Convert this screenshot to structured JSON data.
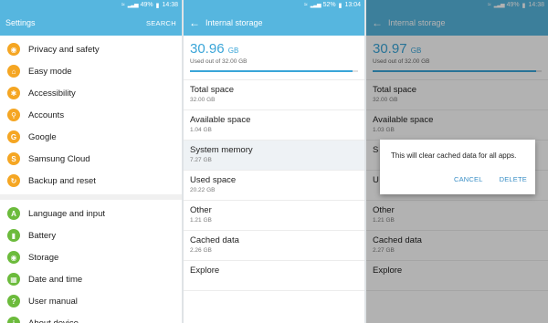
{
  "status": {
    "p1_battery": "49%",
    "p1_time": "14:38",
    "p2_battery": "52%",
    "p2_time": "13:04",
    "p3_battery": "49%",
    "p3_time": "14:38"
  },
  "settings": {
    "title": "Settings",
    "search_label": "SEARCH",
    "items": [
      {
        "label": "Privacy and safety",
        "icon": "privacy-icon",
        "color": "#f5a623"
      },
      {
        "label": "Easy mode",
        "icon": "easy-mode-icon",
        "color": "#f5a623"
      },
      {
        "label": "Accessibility",
        "icon": "accessibility-icon",
        "color": "#f5a623"
      },
      {
        "label": "Accounts",
        "icon": "key-icon",
        "color": "#f5a623"
      },
      {
        "label": "Google",
        "icon": "google-icon",
        "color": "#f5a623"
      },
      {
        "label": "Samsung Cloud",
        "icon": "samsung-cloud-icon",
        "color": "#f5a623"
      },
      {
        "label": "Backup and reset",
        "icon": "backup-icon",
        "color": "#f5a623"
      },
      {
        "label": "Language and input",
        "icon": "language-icon",
        "color": "#6cbb3c"
      },
      {
        "label": "Battery",
        "icon": "battery-icon",
        "color": "#6cbb3c"
      },
      {
        "label": "Storage",
        "icon": "storage-icon",
        "color": "#6cbb3c"
      },
      {
        "label": "Date and time",
        "icon": "calendar-icon",
        "color": "#6cbb3c"
      },
      {
        "label": "User manual",
        "icon": "user-manual-icon",
        "color": "#6cbb3c"
      },
      {
        "label": "About device",
        "icon": "info-icon",
        "color": "#6cbb3c"
      }
    ]
  },
  "storage_a": {
    "title": "Internal storage",
    "used_value": "30.96",
    "used_unit": "GB",
    "used_caption": "Used out of 32.00 GB",
    "used_fraction": 0.9675,
    "rows": [
      {
        "label": "Total space",
        "value": "32.00 GB"
      },
      {
        "label": "Available space",
        "value": "1.04 GB"
      },
      {
        "label": "System memory",
        "value": "7.27 GB"
      },
      {
        "label": "Used space",
        "value": "20.22 GB"
      },
      {
        "label": "Other",
        "value": "1.21 GB"
      },
      {
        "label": "Cached data",
        "value": "2.26 GB"
      },
      {
        "label": "Explore",
        "value": ""
      }
    ]
  },
  "storage_b": {
    "title": "Internal storage",
    "used_value": "30.97",
    "used_unit": "GB",
    "used_caption": "Used out of 32.00 GB",
    "used_fraction": 0.9678,
    "rows": [
      {
        "label": "Total space",
        "value": "32.00 GB"
      },
      {
        "label": "Available space",
        "value": "1.03 GB"
      },
      {
        "label": "S",
        "value": ""
      },
      {
        "label": "U",
        "value": ""
      },
      {
        "label": "Other",
        "value": "1.21 GB"
      },
      {
        "label": "Cached data",
        "value": "2.27 GB"
      },
      {
        "label": "Explore",
        "value": ""
      }
    ]
  },
  "dialog": {
    "message": "This will clear cached data for all apps.",
    "cancel_label": "CANCEL",
    "delete_label": "DELETE"
  }
}
